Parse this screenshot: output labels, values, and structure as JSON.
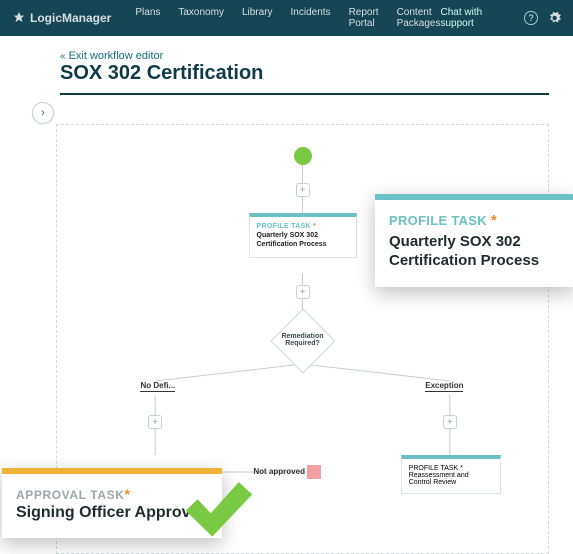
{
  "brand": "LogicManager",
  "nav": {
    "items": [
      "Plans",
      "Taxonomy",
      "Library",
      "Incidents",
      "Report Portal",
      "Content Packages"
    ],
    "chat": "Chat with support"
  },
  "editor": {
    "exit": "Exit workflow editor",
    "title": "SOX 302 Certification"
  },
  "flow": {
    "task1": {
      "label": "PROFILE TASK",
      "body": "Quarterly SOX 302 Certification Process"
    },
    "decision": "Remediation Required?",
    "branch_left": "No Defi...",
    "branch_right": "Exception",
    "not_approved": "Not approved",
    "task2": {
      "label": "PROFILE TASK",
      "body": "Reassessment and Control Review"
    }
  },
  "callout_profile": {
    "label": "PROFILE TASK",
    "body": "Quarterly SOX 302 Certification Process"
  },
  "callout_approval": {
    "label": "APPROVAL TASK",
    "body": "Signing Officer Approval"
  }
}
